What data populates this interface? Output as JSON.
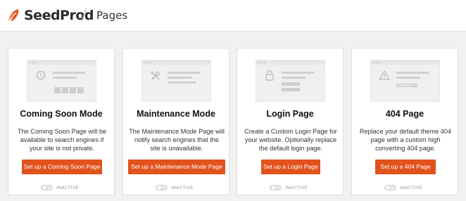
{
  "header": {
    "brand": "SeedProd",
    "separator": "/",
    "page_title": "Pages",
    "brand_color": "#e2521d"
  },
  "cards": [
    {
      "title": "Coming Soon Mode",
      "description": "The Coming Soon Page will be available to search engines if your site is not private.",
      "button_label": "Set up a Coming Soon Page",
      "status_label": "INACTIVE",
      "active": false,
      "illustration_icon": "clock-icon"
    },
    {
      "title": "Maintenance Mode",
      "description": "The Maintenance Mode Page will notify search engines that the site is unavailable.",
      "button_label": "Set up a Maintenance Mode Page",
      "status_label": "INACTIVE",
      "active": false,
      "illustration_icon": "tools-icon"
    },
    {
      "title": "Login Page",
      "description": "Create a Custom Login Page for your website. Optionally replace the default login page.",
      "button_label": "Set up a Login Page",
      "status_label": "INACTIVE",
      "active": false,
      "illustration_icon": "lock-icon"
    },
    {
      "title": "404 Page",
      "description": "Replace your default theme 404 page with a custom high converting 404 page.",
      "button_label": "Set up a 404 Page",
      "status_label": "INACTIVE",
      "active": false,
      "illustration_icon": "warning-icon"
    }
  ]
}
